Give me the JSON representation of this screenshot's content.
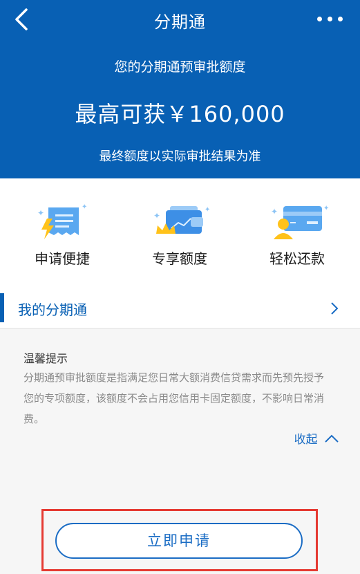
{
  "header": {
    "title": "分期通",
    "subtitle": "您的分期通预审批额度",
    "amount": "最高可获￥160,000",
    "note": "最终额度以实际审批结果为准",
    "color": "#0860b4"
  },
  "features": [
    {
      "label": "申请便捷",
      "icon": "receipt-lightning-icon"
    },
    {
      "label": "专享额度",
      "icon": "wallet-crown-icon"
    },
    {
      "label": "轻松还款",
      "icon": "card-user-icon"
    }
  ],
  "my_row": {
    "label": "我的分期通"
  },
  "tips": {
    "title": "温馨提示",
    "body": "分期通预审批额度是指满足您日常大额消费信贷需求而先预先授予您的专项额度，该额度不会占用您信用卡固定额度，不影响日常消费。",
    "collapse_label": "收起"
  },
  "apply_button": {
    "label": "立即申请"
  },
  "accent": "#1a6cc4",
  "highlight_color": "#e53a32"
}
